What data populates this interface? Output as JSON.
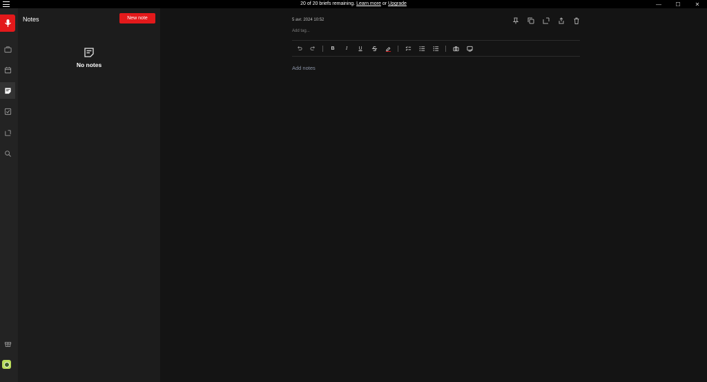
{
  "titlebar": {
    "banner_prefix": "20 of 20 briefs remaining.",
    "learn_more": "Learn more",
    "or": "or",
    "upgrade": "Upgrade",
    "minimize": "—",
    "maximize": "☐",
    "close": "✕"
  },
  "colors": {
    "accent": "#e3191b",
    "rail": "#232323",
    "panel": "#1c1c1c",
    "editor": "#141414"
  },
  "rail": {
    "items": [
      "briefcase-icon",
      "calendar-icon",
      "notes-icon",
      "tasks-icon",
      "share-icon",
      "search-icon",
      "gift-icon"
    ],
    "active": "notes-icon"
  },
  "notes_panel": {
    "title": "Notes",
    "new_note_label": "New note",
    "empty_text": "No notes"
  },
  "editor": {
    "date": "5 avr. 2024 10:52",
    "add_tag": "Add tag...",
    "body_placeholder": "Add notes",
    "actions": [
      "pin-icon",
      "copy-icon",
      "share-icon",
      "export-icon",
      "trash-icon"
    ],
    "toolbar": {
      "bold": "B",
      "italic": "I",
      "underline": "U"
    }
  }
}
